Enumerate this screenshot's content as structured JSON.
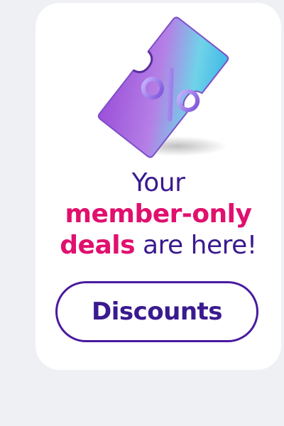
{
  "promo": {
    "headline_line1": "Your",
    "headline_accent_line2": "member-only",
    "headline_accent_line3": "deals",
    "headline_rest_line3": " are here!",
    "cta_label": "Discounts",
    "icon": "percent-ticket-icon"
  },
  "colors": {
    "page_background": "#eef0f3",
    "card_background": "#ffffff",
    "headline_text": "#3a1a8f",
    "accent_text": "#e0106e",
    "button_border": "#4a1aa0"
  }
}
